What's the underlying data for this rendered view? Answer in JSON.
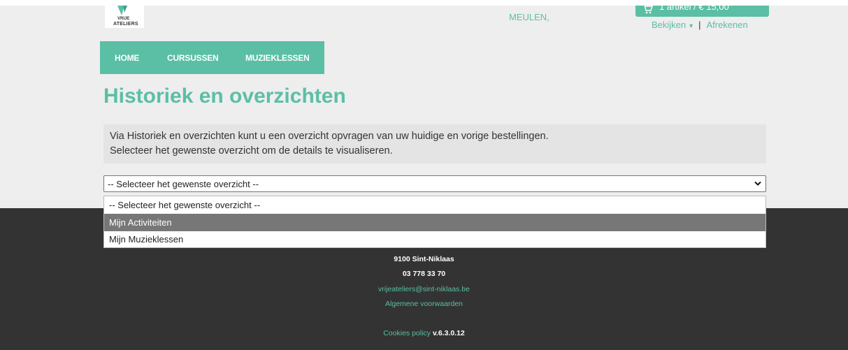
{
  "header": {
    "logo": {
      "line1": "VRIJE",
      "line2": "ATELIERS"
    },
    "user_name": "MEULEN,",
    "cart": {
      "summary": "1 artikel / € 15,00",
      "view_label": "Bekijken",
      "separator": "|",
      "checkout_label": "Afrekenen"
    }
  },
  "nav": {
    "items": [
      {
        "label": "HOME"
      },
      {
        "label": "CURSUSSEN"
      },
      {
        "label": "MUZIEKLESSEN"
      }
    ]
  },
  "main": {
    "title": "Historiek en overzichten",
    "info_line1": "Via Historiek en overzichten kunt u een overzicht opvragen van uw huidige en vorige bestellingen.",
    "info_line2": "Selecteer het gewenste overzicht om de details te visualiseren.",
    "select": {
      "value": "-- Selecteer het gewenste overzicht --",
      "options": [
        {
          "label": "-- Selecteer het gewenste overzicht --"
        },
        {
          "label": "Mijn Activiteiten",
          "highlighted": true
        },
        {
          "label": "Mijn Muzieklessen"
        }
      ]
    }
  },
  "footer": {
    "postcode_city": "9100 Sint-Niklaas",
    "phone": "03 778 33 70",
    "email": "vrijeateliers@sint-niklaas.be",
    "terms_link": "Algemene voorwaarden",
    "cookies_link": "Cookies policy",
    "version": "v.6.3.0.12"
  },
  "colors": {
    "accent": "#5bbfa5",
    "footer_bg": "#333333",
    "page_bg": "#eeeeee",
    "highlight": "#777777"
  },
  "icons": {
    "cart": "shopping-cart-icon",
    "view_caret": "caret-down-icon",
    "select_arrow": "chevron-down-icon",
    "logo": "vrije-ateliers-logo"
  }
}
